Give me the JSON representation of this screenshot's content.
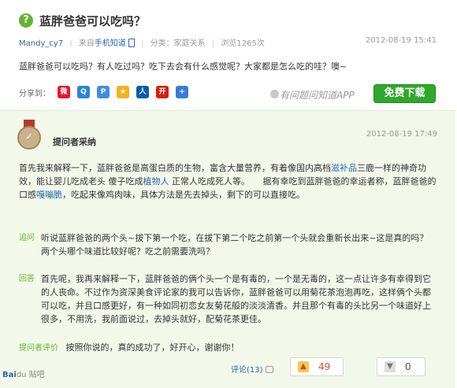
{
  "question": {
    "icon": "?",
    "title": "蓝胖爸爸可以吃吗？",
    "user": "Mandy_cy7",
    "source_prefix": "来自",
    "source": "手机知道",
    "category": "分类：家庭关系",
    "views": "浏览1265次",
    "date": "2012-08-19 15:41",
    "body": "蓝胖爸爸可以吃吗？有人吃过吗？吃下去会有什么感觉呢？大家都是怎么吃的哇？噢~"
  },
  "share": {
    "label": "分享到：",
    "icons": [
      {
        "name": "weibo-icon",
        "glyph": "微",
        "color": "#e6162d"
      },
      {
        "name": "qzone-icon",
        "glyph": "Q",
        "color": "#2b83d6"
      },
      {
        "name": "tieba-icon",
        "glyph": "P",
        "color": "#3d8fe0"
      },
      {
        "name": "star-icon",
        "glyph": "★",
        "color": "#f2b31b"
      },
      {
        "name": "renren-icon",
        "glyph": "人",
        "color": "#005eac"
      },
      {
        "name": "kaixin-icon",
        "glyph": "开",
        "color": "#d81e06"
      },
      {
        "name": "more-icon",
        "glyph": "+",
        "color": "#3a7bd5"
      }
    ]
  },
  "app_promo": {
    "text": "有问题问知道APP",
    "button": "免费下载"
  },
  "answer": {
    "label": "提问者采纳",
    "date": "2012-08-19 17:49",
    "p1_a": "首先我来解释一下，蓝胖爸爸是高蛋白质的生物，富含大量营养，有着像国内高档",
    "p1_link1": "滋补品",
    "p1_b": "三鹿一样的神奇功效，能让婴儿吃成老头 傻子吃成",
    "p1_link2": "植物人",
    "p1_c": " 正常人吃成死人等。　　据有幸吃到蓝胖爸爸的幸运者称，蓝胖爸爸的口感",
    "p1_link3": "嘎嘣脆",
    "p1_d": "，吃起来像鸡肉味，具体方法是先去掉头，剩下的可以直接吃。"
  },
  "followup1": {
    "tag": "追问",
    "text": "听说蓝胖爸爸的两个头~拔下第一个吃，在拔下第二个吃之前第一个头就会重新长出来~这是真的吗？两个头哪个味道比较好呢？吃之前需要洗吗？"
  },
  "followup2": {
    "tag": "回答",
    "text": "首先呢，我再来解释一下，蓝胖爸爸的俩个头一个是有毒的，一个是无毒的，这一点让许多有幸得到它的人丧命。不过作为资深美食评论家的我可以告诉你，蓝胖爸爸可以用菊花茶泡泡再吃，这样俩个头都可以吃，并且口感更好，有一种如同初恋女友菊花般的淡淡清香。并且那个有毒的头比另一个味道好上很多，不用洗，我前面说过，去掉头就好，配菊花茶更佳。"
  },
  "evaluation": {
    "tag": "提问者评价",
    "text": "按照你说的，真的成功了，好开心，谢谢你！"
  },
  "footer": {
    "comment": "评论(13)",
    "up": "49",
    "down": "0",
    "watermark_brand": "Bai",
    "watermark_rest": "du 贴吧"
  },
  "colors": {
    "accent_green": "#67b22f",
    "link_blue": "#2d64b3",
    "answer_bg": "#f2f9ea",
    "download_green": "#2fa82c"
  }
}
